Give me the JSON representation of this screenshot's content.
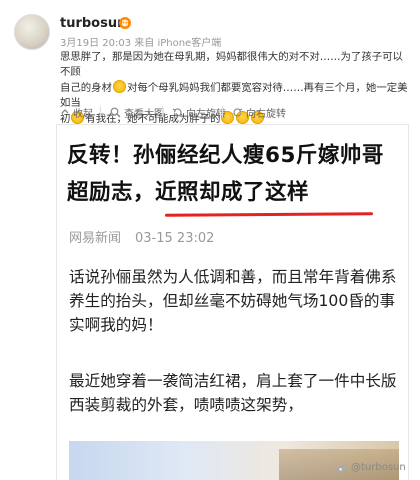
{
  "post": {
    "username": "turbosun",
    "meta": "3月19日 20:03 来自 iPhone客户端",
    "text_line1": "思思胖了，那是因为她在母乳期，妈妈都很伟大的对不对……为了孩子可以不顾",
    "text_line2a": "自己的身材",
    "text_line2b": "对每个母乳妈妈我们都要宽容对待……再有三个月，她一定美如当",
    "text_line3a": "初",
    "text_line3b": "有我在，她不可能成为胖子的"
  },
  "toolbar": {
    "collect": "收起",
    "view_large": "查看大图",
    "rotate_left": "向左旋转",
    "rotate_right": "向右旋转"
  },
  "article": {
    "headline_line1": "反转！孙俪经纪人瘦65斤嫁帅哥",
    "headline_line2a": "超励志，",
    "headline_line2b": "近照却成了这样",
    "source": "网易新闻",
    "date": "03-15 23:02",
    "para1": "话说孙俪虽然为人低调和善，而且常年背着佛系养生的抬头，但却丝毫不妨碍她气场100昏的事实啊我的妈！",
    "para2": "最近她穿着一袭简洁红裙，肩上套了一件中长版西装剪裁的外套，啧啧啧这架势，"
  },
  "watermark": {
    "text": "@turbosun"
  },
  "colors": {
    "underline": "#e32222"
  }
}
